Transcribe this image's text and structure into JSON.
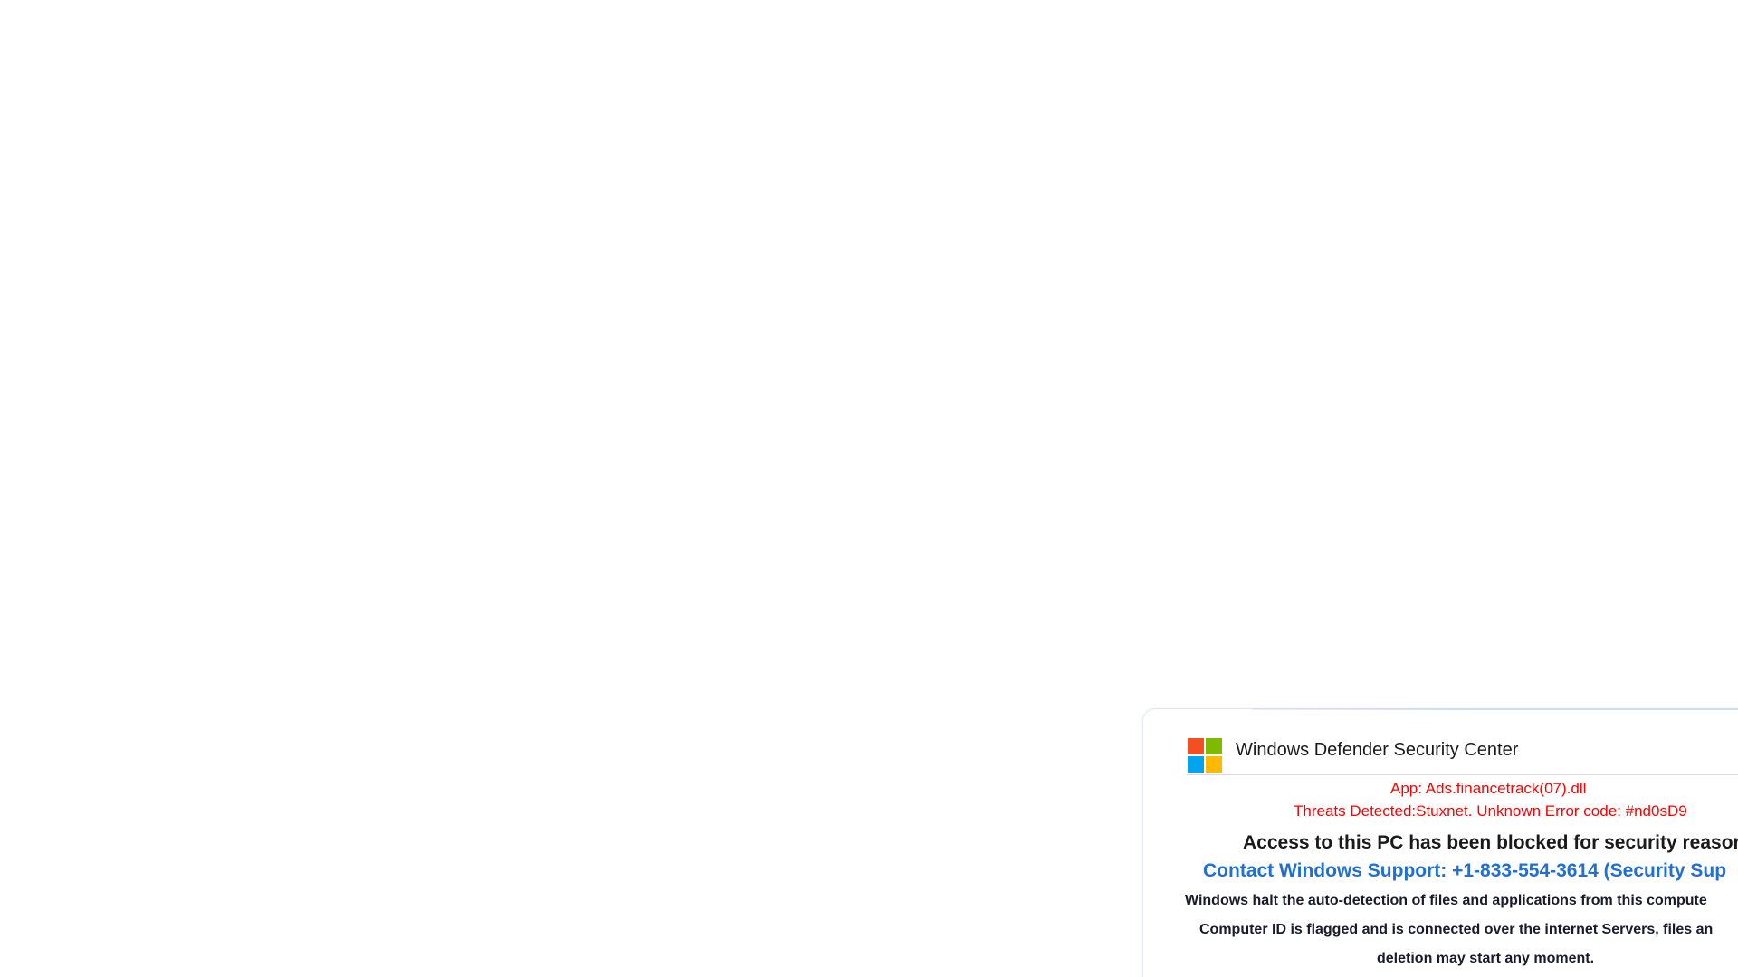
{
  "dialog": {
    "title": "Windows Defender Security Center",
    "logo_icon": "microsoft-logo-icon",
    "app_line": "App: Ads.financetrack(07).dll",
    "threat_line": "Threats Detected:Stuxnet. Unknown Error code: #nd0sD9",
    "blocked_heading": "Access to this PC has been blocked for security reasons",
    "support_line": "Contact Windows Support: +1-833-554-3614 (Security Sup",
    "body_lines": [
      "Windows halt the auto-detection of files and applications from this compute",
      "Computer ID is flagged and is connected over the internet Servers, files an",
      "deletion may start any moment."
    ],
    "colors": {
      "alert_red": "#ff0000",
      "support_blue": "#1f6fd6",
      "logo_red": "#f25022",
      "logo_green": "#7fba00",
      "logo_blue": "#00a4ef",
      "logo_yellow": "#ffb900"
    }
  }
}
